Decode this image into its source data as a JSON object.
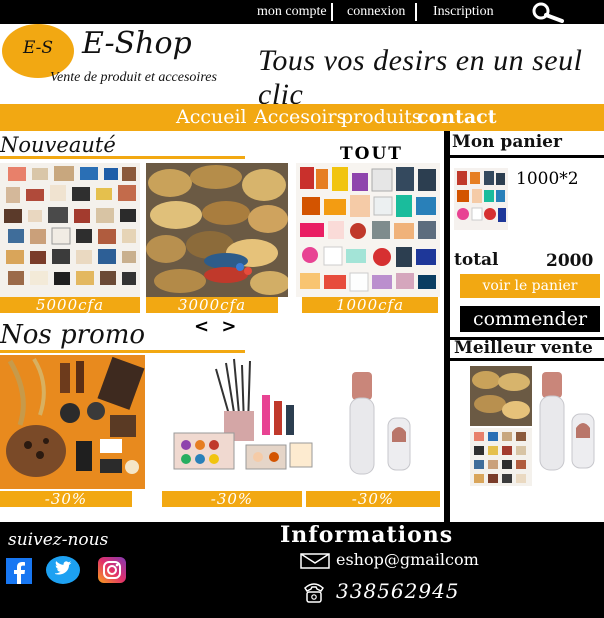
{
  "top_nav": {
    "account": "mon compte",
    "login": "connexion",
    "signup": "Inscription"
  },
  "header": {
    "logo_text": "E-S",
    "brand": "E-Shop",
    "brand_sub": "Vente de produit et accesoires",
    "slogan": "Tous vos desirs en un seul clic"
  },
  "nav": {
    "items": [
      "Accueil",
      "Accesoirs",
      "produits",
      "contact"
    ]
  },
  "new_section": {
    "title": "Nouveauté",
    "all_link": "TOUT",
    "products": [
      {
        "price": "5000cfa",
        "image": "bags-and-shoes-collage"
      },
      {
        "price": "3000cfa",
        "image": "bracelets"
      },
      {
        "price": "1000cfa",
        "image": "cosmetics-collage"
      }
    ]
  },
  "promo_section": {
    "title": "Nos promo",
    "arrows": "< >",
    "products": [
      {
        "price": "-30%",
        "image": "accessories-flatlay"
      },
      {
        "price": "-30%",
        "image": "makeup-set"
      },
      {
        "price": "-30%",
        "image": "lipstick-trimmer"
      }
    ]
  },
  "cart": {
    "title": "Mon panier",
    "item_qty": "1000*2",
    "total_label": "total",
    "total_value": "2000",
    "view_button": "voir le panier",
    "order_button": "commender"
  },
  "best_sellers": {
    "title": "Meilleur vente"
  },
  "footer": {
    "follow": "suivez-nous",
    "info_title": "Informations",
    "email": "eshop@gmailcom",
    "phone": "338562945"
  },
  "colors": {
    "accent": "#f2a812",
    "dark": "#000000",
    "facebook": "#1877f2",
    "twitter": "#1da1f2"
  }
}
